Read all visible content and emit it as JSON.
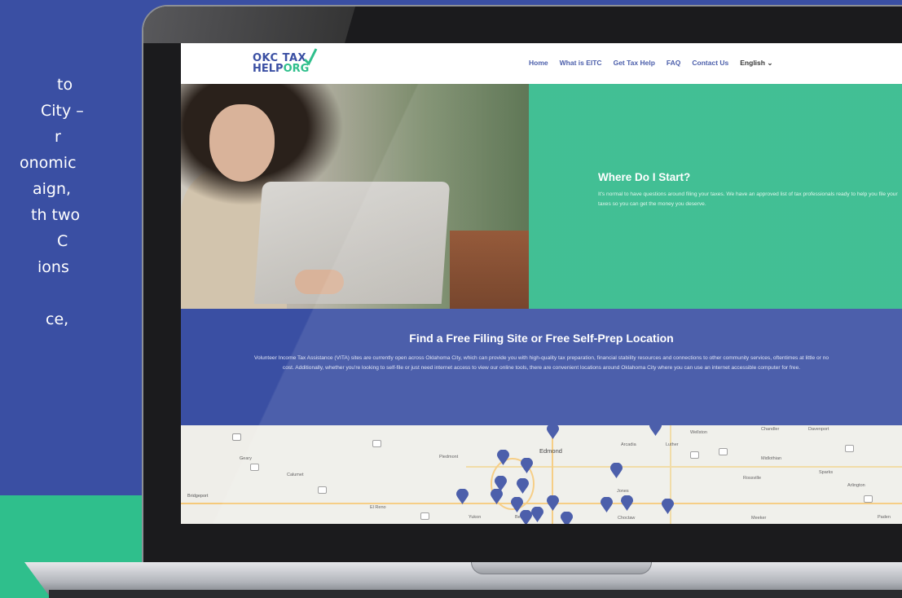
{
  "left_panel": {
    "lines": [
      "to",
      "City –",
      "r",
      "onomic",
      "aign,",
      "th two",
      "C",
      "ions",
      "ce,"
    ],
    "background": "#3a4fa3",
    "accent": "#2fbf8c"
  },
  "site": {
    "logo_line1": "OKC TAX",
    "logo_line2_a": "HELP",
    "logo_line2_b": "ORG",
    "nav": [
      "Home",
      "What is EITC",
      "Get Tax Help",
      "FAQ",
      "Contact Us"
    ],
    "language": "English ⌄",
    "hero": {
      "title": "Where Do I Start?",
      "body": "It's normal to have questions around filing your taxes. We have an approved list of tax professionals ready to help you file your taxes so you can get the money you deserve."
    },
    "band": {
      "title": "Find a Free Filing Site or Free Self-Prep Location",
      "body": "Volunteer Income Tax Assistance (VITA) sites are currently open across Oklahoma City, which can provide you with high-quality tax preparation, financial stability resources and connections to other community services, oftentimes at little or no cost. Additionally, whether you're looking to self-file or just need internet access to view our online tools, there are convenient locations around Oklahoma City where you can use an internet accessible computer for free."
    },
    "map": {
      "towns": [
        "Geary",
        "Calumet",
        "Bridgeport",
        "Piedmont",
        "Edmond",
        "Arcadia",
        "Luther",
        "Wellston",
        "Chandler",
        "Davenport",
        "Midlothian",
        "Sparks",
        "Rossville",
        "Arlington",
        "Jones",
        "El Reno",
        "Yukon",
        "Bethany",
        "Choctaw",
        "Meeker",
        "Paden"
      ],
      "pin_color": "#3a4fa3"
    },
    "colors": {
      "blue": "#3a4fa3",
      "green": "#2fb98a"
    }
  }
}
